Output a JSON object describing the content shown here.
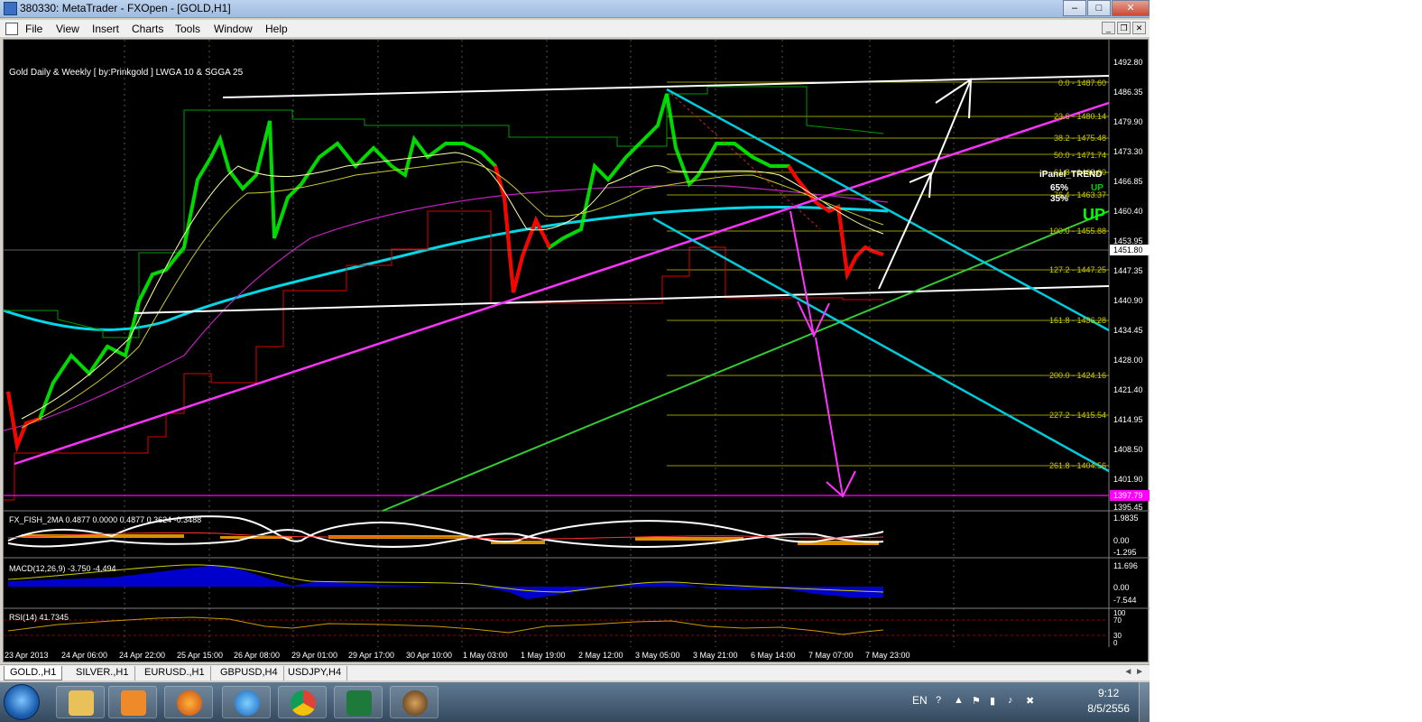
{
  "window": {
    "title": "380330: MetaTrader - FXOpen - [GOLD,H1]",
    "buttons": {
      "minimize": "–",
      "maximize": "□",
      "close": "✕"
    }
  },
  "menu": [
    "File",
    "View",
    "Insert",
    "Charts",
    "Tools",
    "Window",
    "Help"
  ],
  "mdi_buttons": [
    "_",
    "❐",
    "✕"
  ],
  "chart": {
    "indicator_label": "Gold Daily & Weekly [ by:Prinkgold ]  LWGA 10  &  SGGA 25",
    "price_scale": [
      "1492.80",
      "1486.35",
      "1479.90",
      "1473.30",
      "1466.85",
      "1460.40",
      "1453.95",
      "1447.35",
      "1440.90",
      "1434.45",
      "1428.00",
      "1421.40",
      "1414.95",
      "1408.50",
      "1401.90",
      "1395.45"
    ],
    "current_price": "1451.80",
    "hline_price": "1397.79",
    "time_labels": [
      "23 Apr 2013",
      "24 Apr 06:00",
      "24 Apr 22:00",
      "25 Apr 15:00",
      "26 Apr 08:00",
      "29 Apr 01:00",
      "29 Apr 17:00",
      "30 Apr 10:00",
      "1 May 03:00",
      "1 May 19:00",
      "2 May 12:00",
      "3 May 05:00",
      "3 May 21:00",
      "6 May 14:00",
      "7 May 07:00",
      "7 May 23:00"
    ],
    "fib_levels": [
      "0.0 - 1487.60",
      "23.6 - 1480.14",
      "38.2 - 1475.48",
      "50.0 - 1471.74",
      "61.8 - 1468.00",
      "76.4 - 1463.37",
      "100.0 - 1455.88",
      "127.2 - 1447.25",
      "161.8 - 1436.28",
      "200.0 - 1424.16",
      "227.2 - 1415.54",
      "261.8 - 1404.56"
    ],
    "ipanel": {
      "title": "iPanel_TREND",
      "pct_up": "65%",
      "pct_down": "35%",
      "label_up": "UP",
      "signal": "UP"
    },
    "colors": {
      "bull": "#00ff00",
      "bear": "#ff0000",
      "pink": "#ff00ff",
      "cyan": "#00ccdd",
      "green": "#33cc33",
      "fib": "#cccc00"
    }
  },
  "subwindows": {
    "fish": {
      "label": "FX_FISH_2MA 0.4877 0.0000 0.4877 0.3624 -0.3488",
      "scale": [
        "1.9835",
        "0.00",
        "-1.295"
      ]
    },
    "macd": {
      "label": "MACD(12,26,9) -3.750 -4.494",
      "scale": [
        "11.696",
        "0.00",
        "-7.544"
      ]
    },
    "rsi": {
      "label": "RSI(14) 41.7345",
      "scale": [
        "100",
        "70",
        "30",
        "0"
      ]
    }
  },
  "tabs": [
    "GOLD.,H1",
    "SILVER.,H1",
    "EURUSD.,H1",
    "GBPUSD,H4",
    "USDJPY,H4"
  ],
  "tab_arrows": "◄ ►",
  "taskbar": {
    "icons": [
      "windows-explorer",
      "media-player",
      "firefox",
      "internet-explorer",
      "chrome",
      "excel",
      "metatrader"
    ],
    "tray_lang": "EN",
    "time": "9:12",
    "date": "8/5/2556"
  }
}
